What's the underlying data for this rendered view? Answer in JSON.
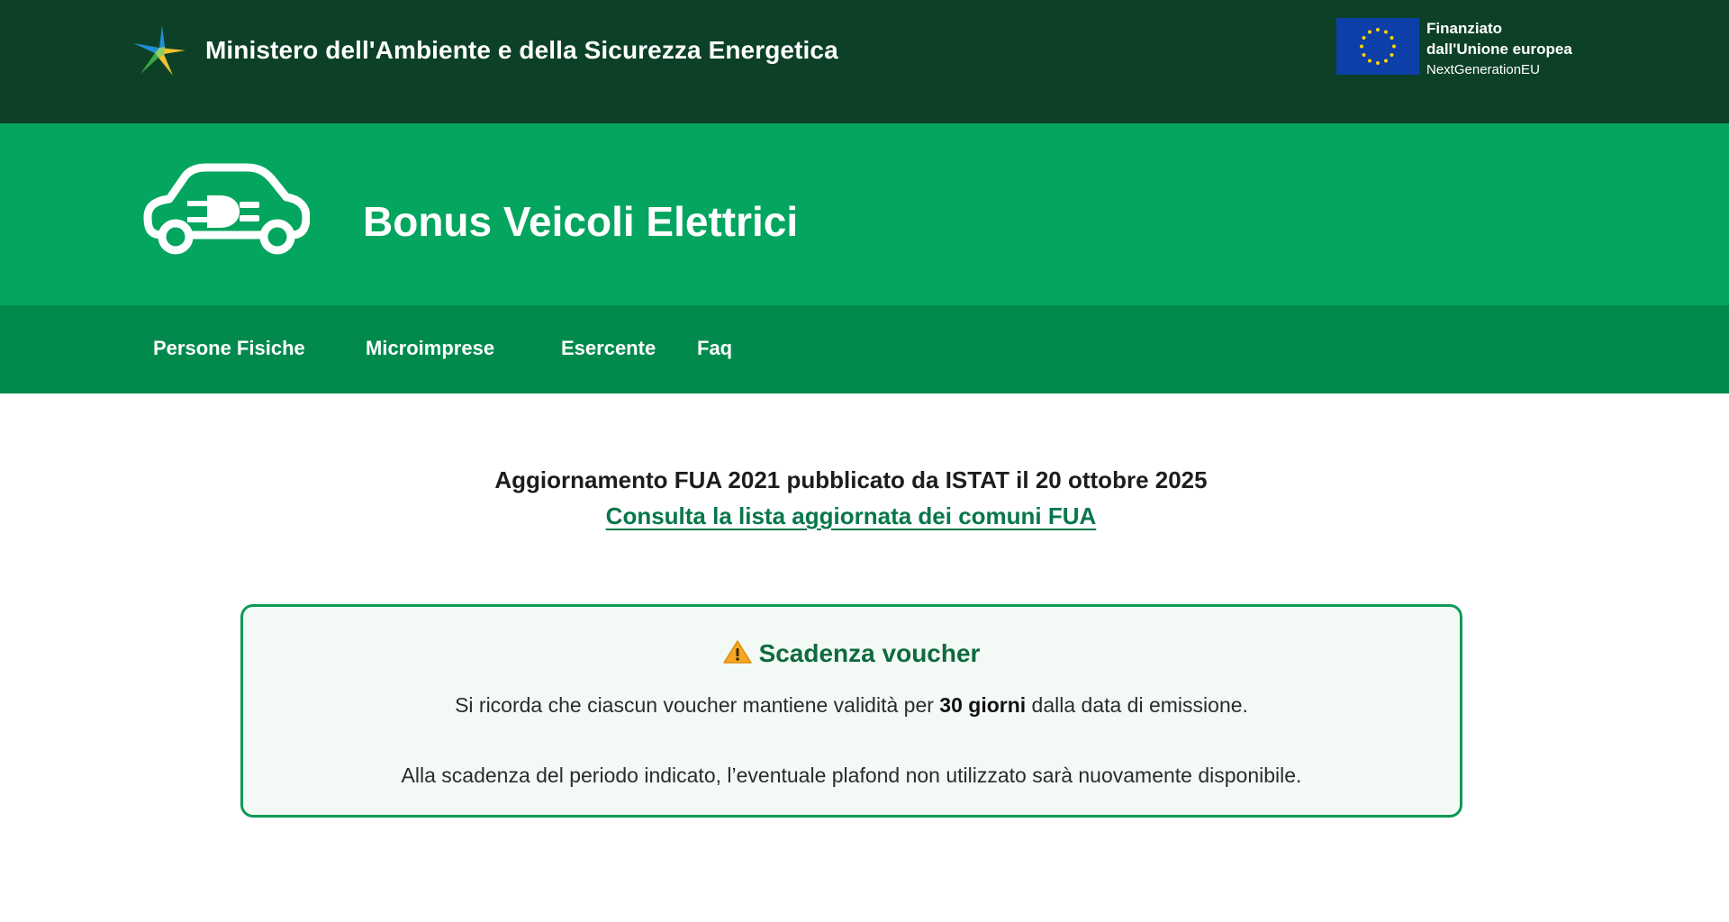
{
  "header": {
    "ministry_name": "Ministero dell'Ambiente e della Sicurezza Energetica",
    "ministry_logo_icon": "star-logo-icon",
    "eu": {
      "flag_icon": "eu-flag-icon",
      "line1": "Finanziato",
      "line2": "dall'Unione europea",
      "line3": "NextGenerationEU"
    }
  },
  "service": {
    "title": "Bonus Veicoli Elettrici",
    "icon": "electric-car-icon"
  },
  "nav": {
    "items": [
      {
        "label": "Persone Fisiche"
      },
      {
        "label": "Microimprese"
      },
      {
        "label": "Esercente"
      },
      {
        "label": "Faq"
      }
    ]
  },
  "main": {
    "announcement": "Aggiornamento FUA 2021 pubblicato da ISTAT il 20 ottobre 2025",
    "link_text": "Consulta la lista aggiornata dei comuni FUA",
    "notice": {
      "icon": "warning-icon",
      "title": "Scadenza voucher",
      "p1_before": "Si ricorda che ciascun voucher mantiene validità per ",
      "p1_bold": "30 giorni",
      "p1_after": " dalla data di emissione.",
      "p2": "Alla scadenza del periodo indicato, l’eventuale plafond non utilizzato sarà nuovamente disponibile."
    }
  },
  "colors": {
    "top_bar": "#0d4127",
    "service_bar": "#04a55e",
    "nav_bar": "#028a4d",
    "link": "#07774a",
    "notice_border": "#0f9a57",
    "notice_bg": "#f3faf6"
  }
}
